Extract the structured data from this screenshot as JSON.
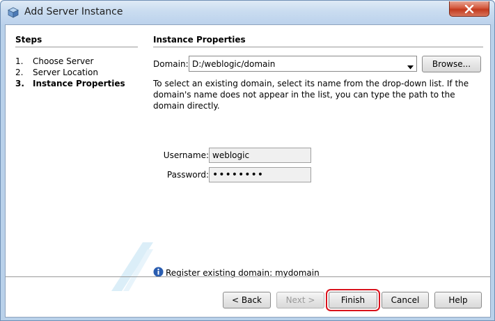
{
  "window": {
    "title": "Add Server Instance"
  },
  "steps": {
    "title": "Steps",
    "items": [
      {
        "num": "1.",
        "label": "Choose Server"
      },
      {
        "num": "2.",
        "label": "Server Location"
      },
      {
        "num": "3.",
        "label": "Instance Properties"
      }
    ],
    "current_index": 2
  },
  "panel": {
    "title": "Instance Properties",
    "domain_label": "Domain:",
    "domain_value": "D:/weblogic/domain",
    "browse_label": "Browse...",
    "help_text": "To select an existing domain, select its name from the drop-down list. If the domain's name does not appear in the list, you can type the path to the domain directly.",
    "username_label": "Username:",
    "username_value": "weblogic",
    "password_label": "Password:",
    "password_value": "••••••••",
    "info_text": "Register existing domain: mydomain"
  },
  "footer": {
    "back_label": "< Back",
    "next_label": "Next >",
    "finish_label": "Finish",
    "cancel_label": "Cancel",
    "help_label": "Help"
  },
  "icons": {
    "app": "cube-icon",
    "close": "close-icon",
    "dropdown": "chevron-down-icon",
    "info": "info-icon"
  },
  "colors": {
    "focus_outline": "#d9121c",
    "title_bar": "#c9dcf0",
    "close_button": "#c23a1e",
    "info_blue": "#2a5db0"
  }
}
